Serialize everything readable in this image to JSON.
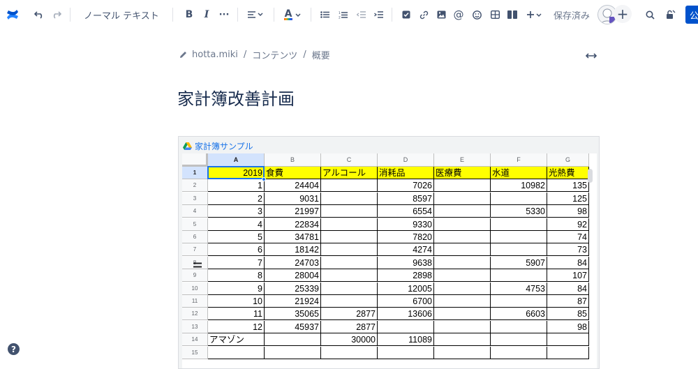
{
  "toolbar": {
    "text_style": "ノーマル テキスト",
    "bold": "B",
    "italic": "I",
    "more": "···",
    "text_color": "A",
    "saved_status": "保存済み",
    "publish_label": "公"
  },
  "breadcrumb": {
    "items": [
      "hotta.miki",
      "コンテンツ",
      "概要"
    ],
    "separator": "/"
  },
  "page": {
    "title": "家計簿改善計画"
  },
  "embed": {
    "title": "家計簿サンプル",
    "columns": [
      "A",
      "B",
      "C",
      "D",
      "E",
      "F",
      "G"
    ],
    "rows": [
      {
        "n": "1",
        "cells": [
          "2019",
          "食費",
          "アルコール",
          "消耗品",
          "医療費",
          "水道",
          "光熱費"
        ]
      },
      {
        "n": "2",
        "cells": [
          "1",
          "24404",
          "",
          "7026",
          "",
          "10982",
          "135"
        ]
      },
      {
        "n": "3",
        "cells": [
          "2",
          "9031",
          "",
          "8597",
          "",
          "",
          "125"
        ]
      },
      {
        "n": "4",
        "cells": [
          "3",
          "21997",
          "",
          "6554",
          "",
          "5330",
          "98"
        ]
      },
      {
        "n": "5",
        "cells": [
          "4",
          "22834",
          "",
          "9330",
          "",
          "",
          "92"
        ]
      },
      {
        "n": "6",
        "cells": [
          "5",
          "34781",
          "",
          "7820",
          "",
          "",
          "74"
        ]
      },
      {
        "n": "7",
        "cells": [
          "6",
          "18142",
          "",
          "4274",
          "",
          "",
          "73"
        ]
      },
      {
        "n": "8",
        "cells": [
          "7",
          "24703",
          "",
          "9638",
          "",
          "5907",
          "84"
        ]
      },
      {
        "n": "9",
        "cells": [
          "8",
          "28004",
          "",
          "2898",
          "",
          "",
          "107"
        ]
      },
      {
        "n": "10",
        "cells": [
          "9",
          "25339",
          "",
          "12005",
          "",
          "4753",
          "84"
        ]
      },
      {
        "n": "11",
        "cells": [
          "10",
          "21924",
          "",
          "6700",
          "",
          "",
          "87"
        ]
      },
      {
        "n": "12",
        "cells": [
          "11",
          "35065",
          "2877",
          "13606",
          "",
          "6603",
          "85"
        ]
      },
      {
        "n": "13",
        "cells": [
          "12",
          "45937",
          "2877",
          "",
          "",
          "",
          "98"
        ]
      },
      {
        "n": "14",
        "cells": [
          "アマゾン",
          "",
          "30000",
          "11089",
          "",
          "",
          ""
        ]
      },
      {
        "n": "15",
        "cells": [
          "",
          "",
          "",
          "",
          "",
          "",
          ""
        ]
      }
    ]
  },
  "help": "?"
}
